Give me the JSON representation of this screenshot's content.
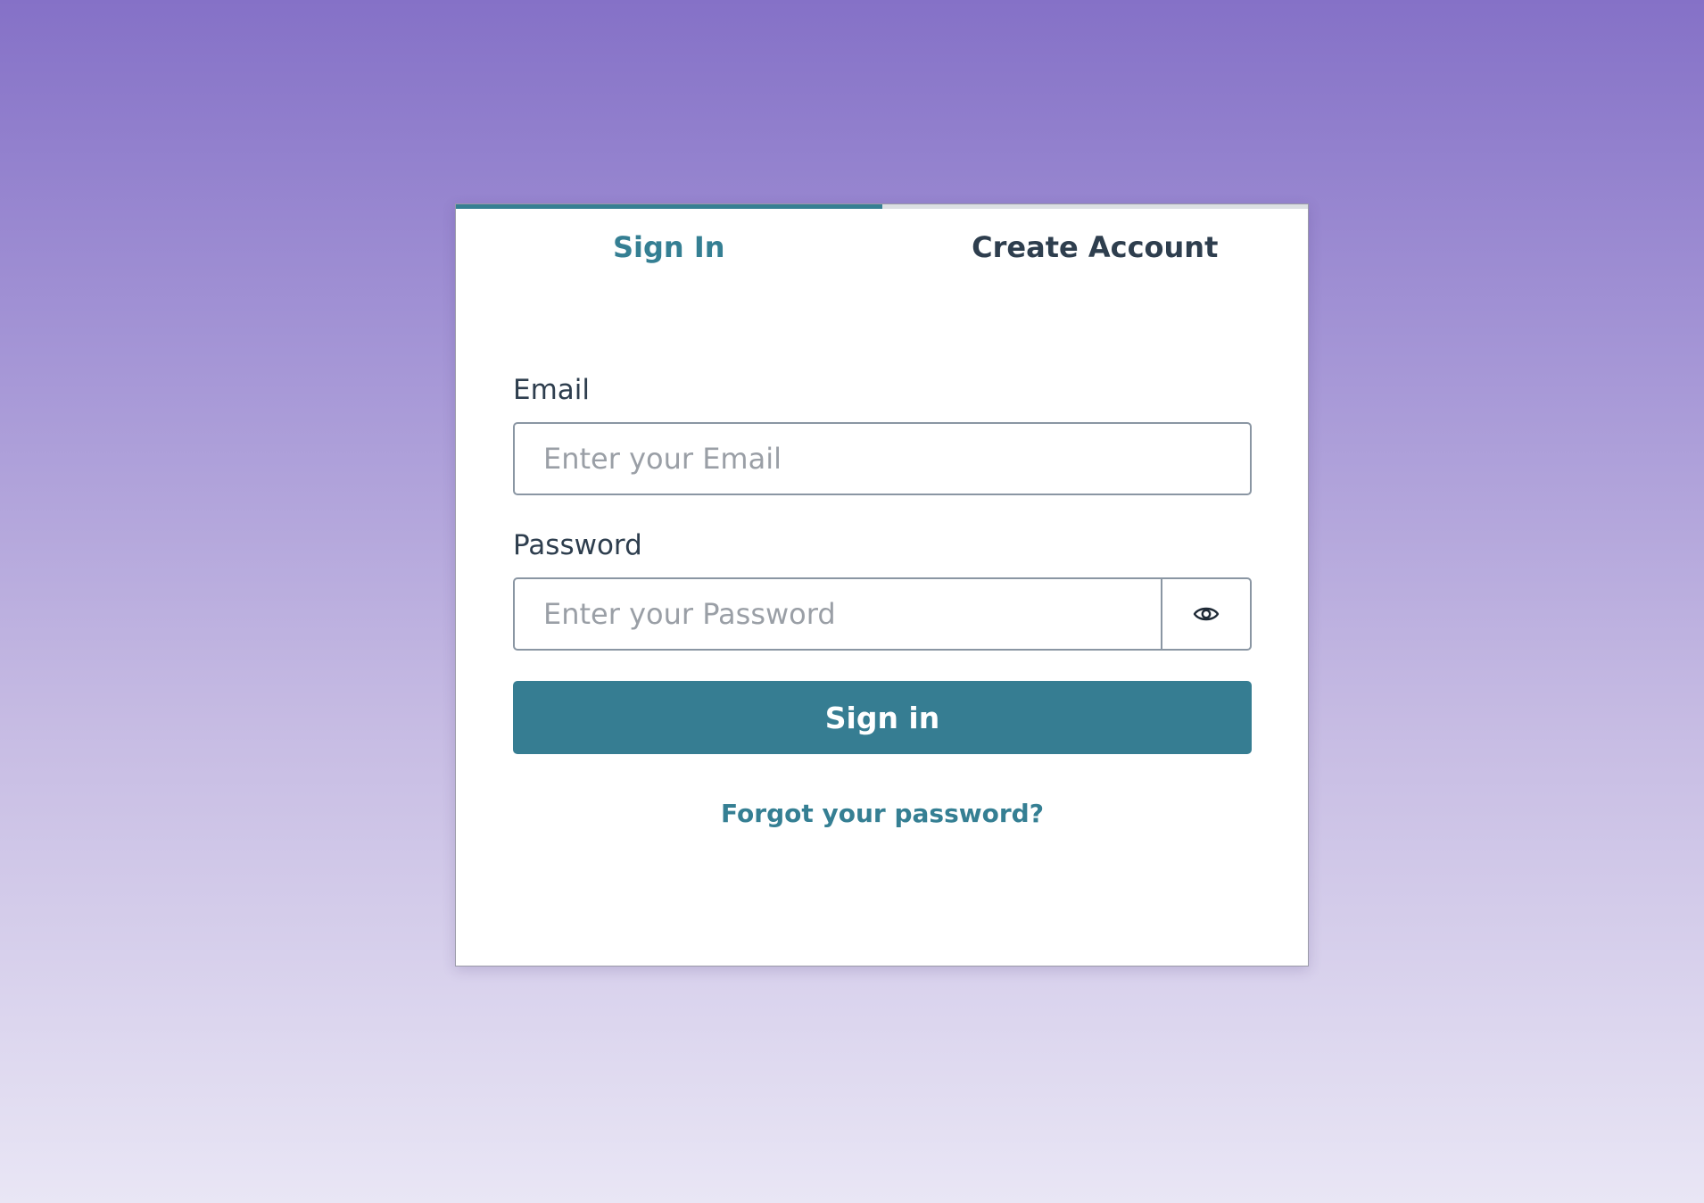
{
  "tabs": {
    "sign_in": "Sign In",
    "create_account": "Create Account"
  },
  "email": {
    "label": "Email",
    "placeholder": "Enter your Email"
  },
  "password": {
    "label": "Password",
    "placeholder": "Enter your Password",
    "toggle_icon": "eye-icon"
  },
  "buttons": {
    "sign_in": "Sign in"
  },
  "links": {
    "forgot_password": "Forgot your password?"
  },
  "colors": {
    "accent": "#357f93",
    "background_top": "#8571c7",
    "background_bottom": "#e9e6f5"
  }
}
